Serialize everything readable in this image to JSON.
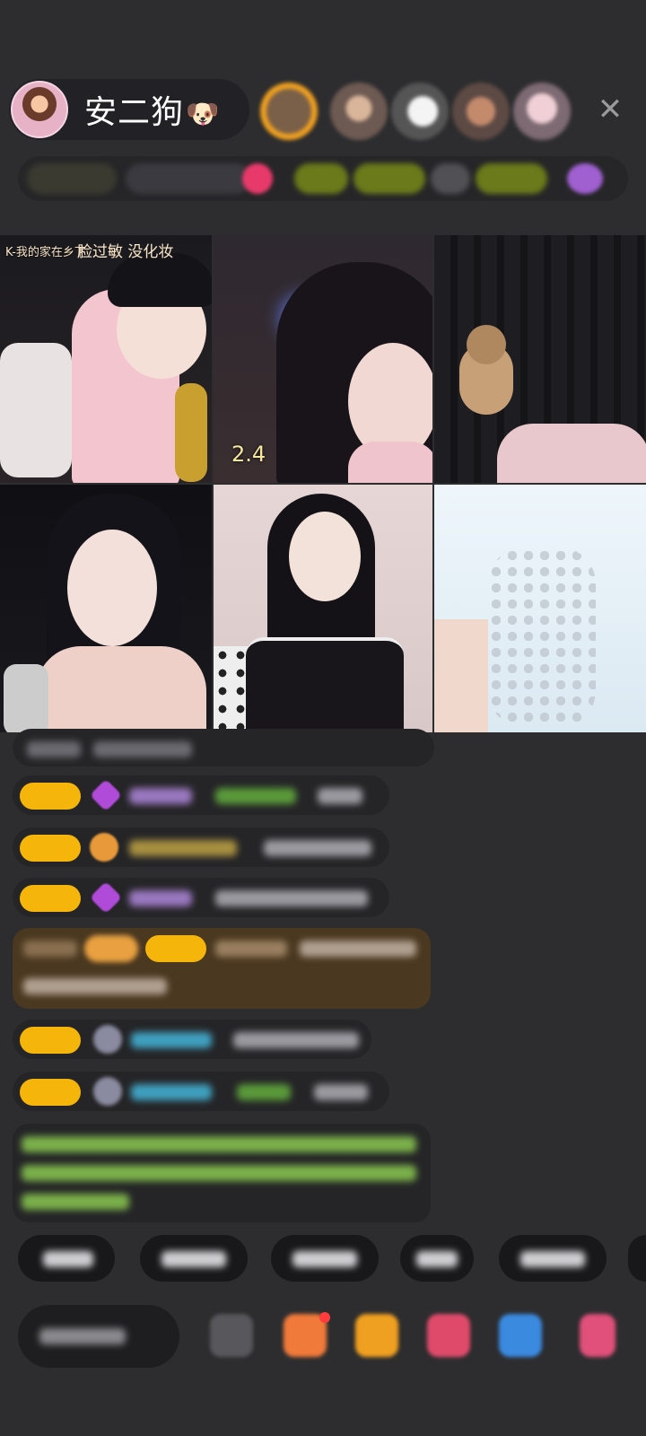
{
  "host": {
    "name": "安二狗",
    "name_emoji": "🐶"
  },
  "header": {
    "close_icon_glyph": "✕"
  },
  "video_grid": {
    "tile1_caption_small": "K-我的家在乡下",
    "tile1_caption_big": "脸过敏 没化妆",
    "tile2_number": "2.4"
  },
  "colors": {
    "background": "#2d2d2f",
    "badge_yellow": "#f5b50a",
    "highlight_brown": "#5a4020",
    "cyan_name": "#3fc3e0",
    "green_name": "#7dbf4a"
  }
}
